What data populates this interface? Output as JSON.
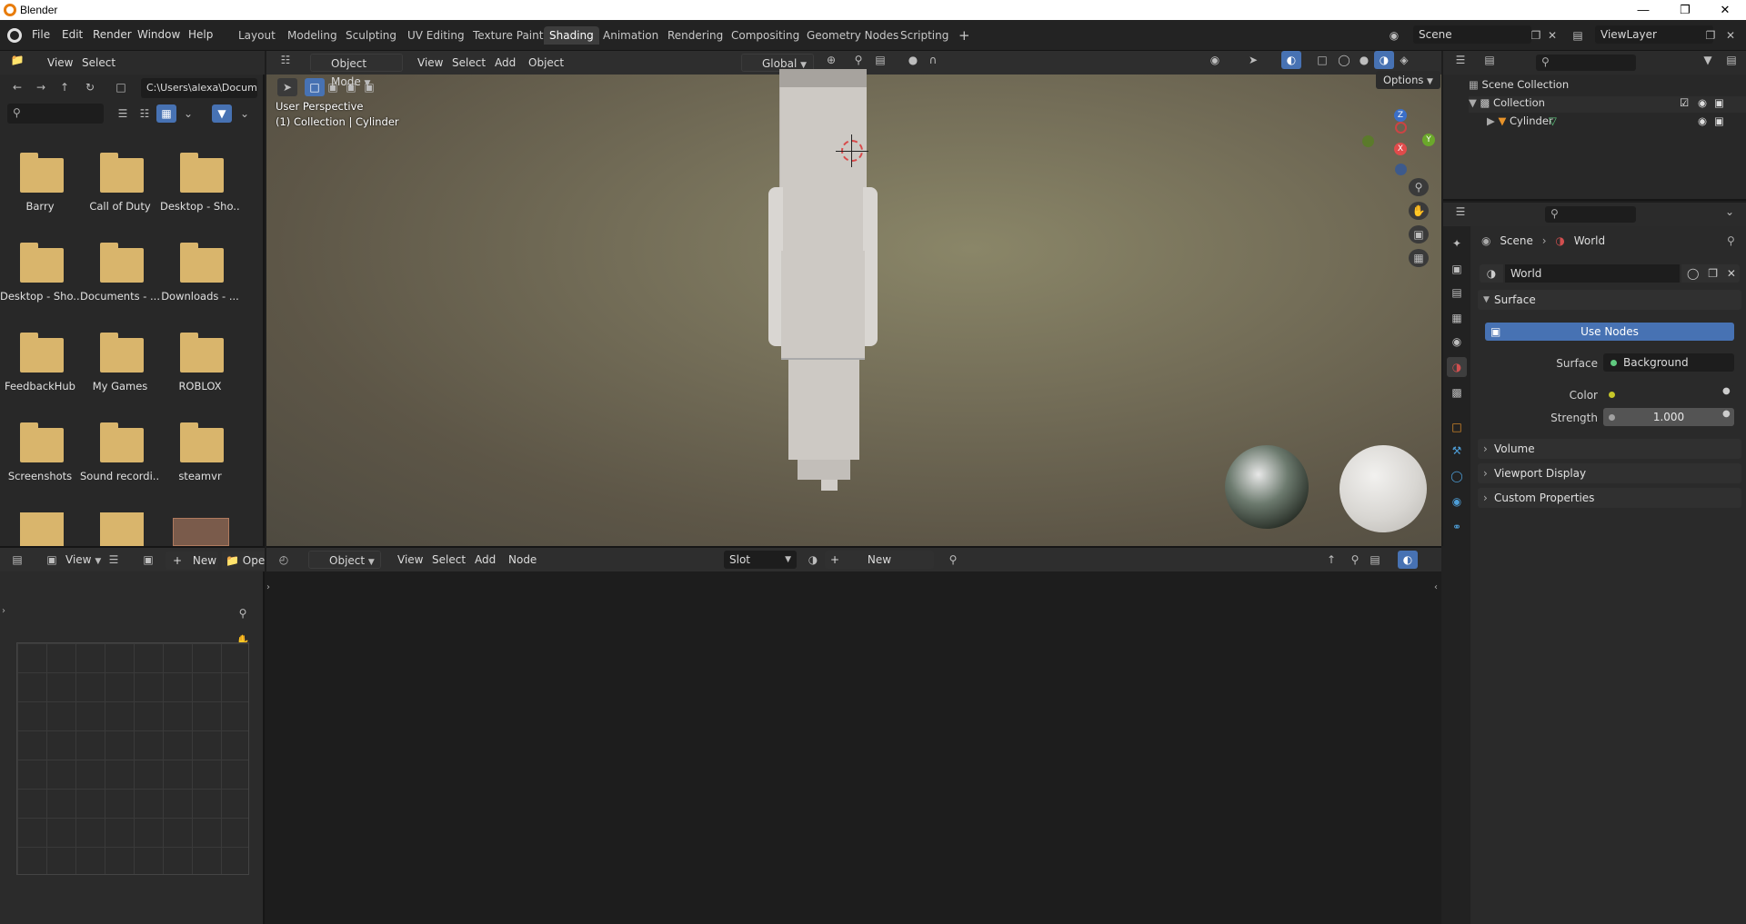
{
  "window": {
    "title": "Blender"
  },
  "menu": [
    "File",
    "Edit",
    "Render",
    "Window",
    "Help"
  ],
  "workspaces": [
    "Layout",
    "Modeling",
    "Sculpting",
    "UV Editing",
    "Texture Paint",
    "Shading",
    "Animation",
    "Rendering",
    "Compositing",
    "Geometry Nodes",
    "Scripting"
  ],
  "active_workspace": "Shading",
  "scene": {
    "name": "Scene",
    "view_layer": "ViewLayer"
  },
  "file_browser": {
    "menus": [
      "View",
      "Select"
    ],
    "path": "C:\\Users\\alexa\\Docum...",
    "folders": [
      "Barry",
      "Call of Duty",
      "Desktop - Sho...",
      "Desktop - Sho...",
      "Documents - ...",
      "Downloads - ...",
      "FeedbackHub",
      "My Games",
      "ROBLOX",
      "Screenshots",
      "Sound recordi...",
      "steamvr"
    ]
  },
  "viewport": {
    "mode": "Object Mode",
    "menus": [
      "View",
      "Select",
      "Add",
      "Object"
    ],
    "transform": "Global",
    "options_label": "Options",
    "perspective": "User Perspective",
    "collection_info": "(1) Collection | Cylinder",
    "gizmo": {
      "z": "Z",
      "y": "Y",
      "x": "X"
    }
  },
  "outliner": {
    "root": "Scene Collection",
    "collection": "Collection",
    "object": "Cylinder"
  },
  "properties": {
    "breadcrumb_scene": "Scene",
    "breadcrumb_world": "World",
    "world_name": "World",
    "surface_panel": "Surface",
    "use_nodes": "Use Nodes",
    "surface_label": "Surface",
    "surface_value": "Background",
    "color_label": "Color",
    "strength_label": "Strength",
    "strength_value": "1.000",
    "panels": [
      "Volume",
      "Viewport Display",
      "Custom Properties"
    ]
  },
  "node_editor": {
    "object_dropdown": "Object",
    "menus": [
      "View",
      "Select",
      "Add",
      "Node"
    ],
    "slot": "Slot",
    "new_label": "New"
  },
  "image_editor": {
    "view": "View",
    "new_label": "New",
    "open_label": "Ope"
  }
}
